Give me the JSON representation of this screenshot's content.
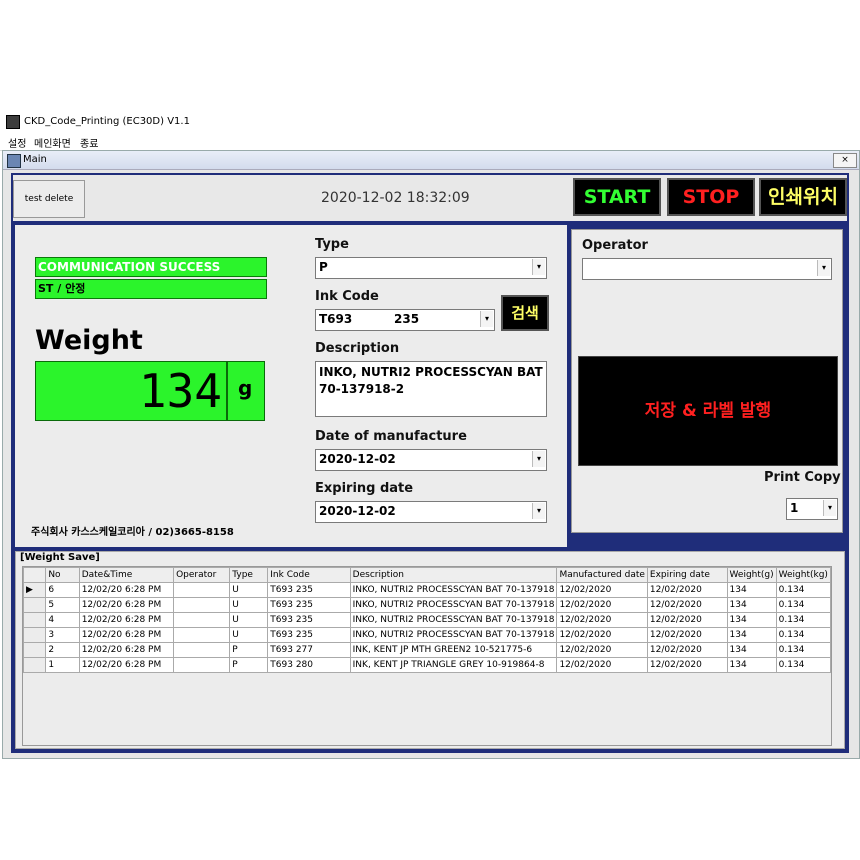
{
  "window": {
    "title": "CKD_Code_Printing (EC30D) V1.1"
  },
  "menu": [
    "설정",
    "메인화면",
    "종료"
  ],
  "child": {
    "title": "Main",
    "close": "×"
  },
  "toolbar": {
    "test_delete": "test delete",
    "datetime": "2020-12-02 18:32:09",
    "start": "START",
    "stop": "STOP",
    "print_pos": "인쇄위치",
    "colors": {
      "start": "#33ff33",
      "stop": "#ff2020",
      "print_pos": "#ffff66"
    }
  },
  "status": {
    "comm": "COMMUNICATION SUCCESS",
    "state": "ST / 안정"
  },
  "weight": {
    "label": "Weight",
    "value": "134",
    "unit": "g"
  },
  "company": "주식회사 카스스케일코리아 /  02)3665-8158",
  "form": {
    "type_label": "Type",
    "type_value": "P",
    "ink_label": "Ink Code",
    "ink_value": "T693          235",
    "search": "검색",
    "desc_label": "Description",
    "desc_value": "INKO, NUTRI2 PROCESSCYAN BAT 70-137918-2",
    "mfg_label": "Date of manufacture",
    "mfg_value": "2020-12-02",
    "exp_label": "Expiring date",
    "exp_value": "2020-12-02"
  },
  "operator": {
    "label": "Operator",
    "value": "",
    "save_print": "저장 & 라벨 발행",
    "print_copy_label": "Print Copy",
    "print_copy_value": "1"
  },
  "table": {
    "title": "[Weight Save]",
    "columns": [
      "",
      "No",
      "Date&Time",
      "Operator",
      "Type",
      "Ink Code",
      "Description",
      "Manufactured date",
      "Expiring date",
      "Weight(g)",
      "Weight(kg)"
    ],
    "rows": [
      [
        "▶",
        "6",
        "12/02/20 6:28 PM",
        "",
        "U",
        "T693          235",
        "INKO, NUTRI2 PROCESSCYAN BAT 70-137918",
        "12/02/2020",
        "12/02/2020",
        "134",
        "0.134"
      ],
      [
        "",
        "5",
        "12/02/20 6:28 PM",
        "",
        "U",
        "T693          235",
        "INKO, NUTRI2 PROCESSCYAN BAT 70-137918",
        "12/02/2020",
        "12/02/2020",
        "134",
        "0.134"
      ],
      [
        "",
        "4",
        "12/02/20 6:28 PM",
        "",
        "U",
        "T693          235",
        "INKO, NUTRI2 PROCESSCYAN BAT 70-137918",
        "12/02/2020",
        "12/02/2020",
        "134",
        "0.134"
      ],
      [
        "",
        "3",
        "12/02/20 6:28 PM",
        "",
        "U",
        "T693          235",
        "INKO, NUTRI2 PROCESSCYAN BAT 70-137918",
        "12/02/2020",
        "12/02/2020",
        "134",
        "0.134"
      ],
      [
        "",
        "2",
        "12/02/20 6:28 PM",
        "",
        "P",
        "T693          277",
        "INK, KENT JP MTH GREEN2 10-521775-6",
        "12/02/2020",
        "12/02/2020",
        "134",
        "0.134"
      ],
      [
        "",
        "1",
        "12/02/20 6:28 PM",
        "",
        "P",
        "T693          280",
        "INK, KENT JP TRIANGLE GREY 10-919864-8",
        "12/02/2020",
        "12/02/2020",
        "134",
        "0.134"
      ]
    ]
  }
}
